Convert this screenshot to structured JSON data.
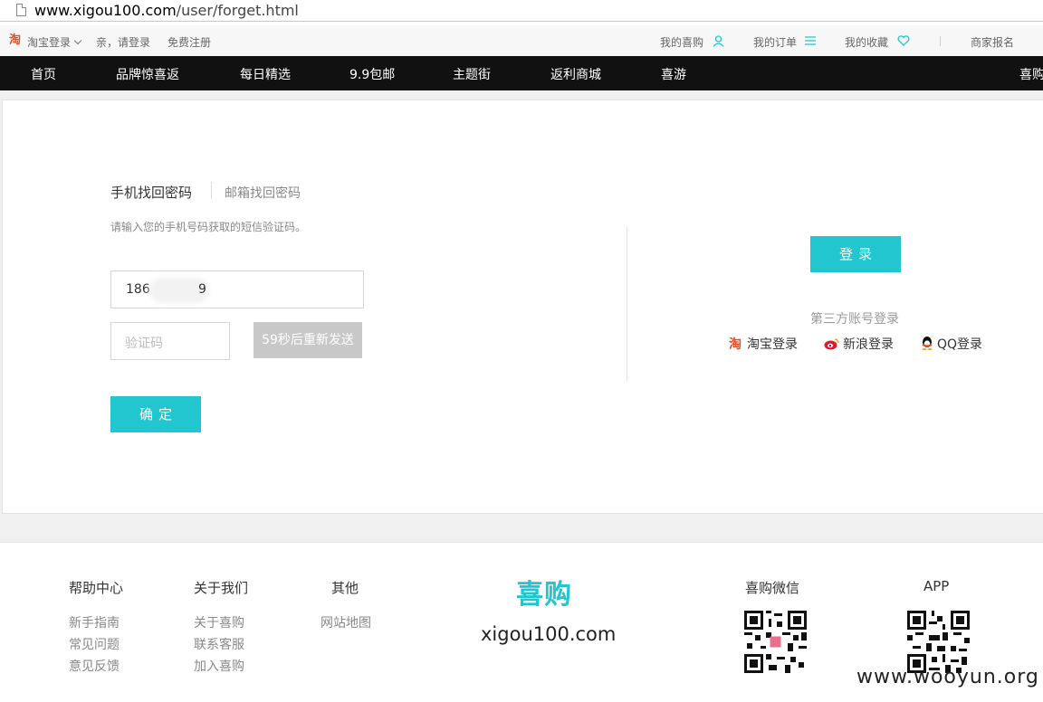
{
  "address_bar": {
    "url_prefix": "www.xigou100.com",
    "url_rest": "/user/forget.html"
  },
  "topbar": {
    "taobao_login": "淘宝登录",
    "greeting": "亲，请登录",
    "register": "免费注册",
    "my_xigou": "我的喜购",
    "my_orders": "我的订单",
    "my_favorites": "我的收藏",
    "merchant_signup": "商家报名",
    "logo_glyph": "淘",
    "accent_color": "#21c6cf"
  },
  "nav": {
    "items": [
      "首页",
      "品牌惊喜返",
      "每日精选",
      "9.9包邮",
      "主题街",
      "返利商城",
      "喜游"
    ],
    "cut_item": "喜购"
  },
  "form": {
    "tab_phone": "手机找回密码",
    "tab_email": "邮箱找回密码",
    "hint": "请输入您的手机号码获取的短信验证码。",
    "phone_value_start": "186",
    "phone_value_end": "9",
    "code_placeholder": "验证码",
    "resend_label": "59秒后重新发送",
    "confirm_label": "确定"
  },
  "side": {
    "login_label": "登录",
    "third_party_title": "第三方账号登录",
    "taobao": "淘宝登录",
    "sina": "新浪登录",
    "qq": "QQ登录"
  },
  "footer": {
    "help_title": "帮助中心",
    "help_links": [
      "新手指南",
      "常见问题",
      "意见反馈"
    ],
    "about_title": "关于我们",
    "about_links": [
      "关于喜购",
      "联系客服",
      "加入喜购"
    ],
    "other_title": "其他",
    "other_links": [
      "网站地图"
    ],
    "brand": "喜购",
    "domain": "xigou100.com",
    "wechat_title": "喜购微信",
    "app_title": "APP"
  },
  "watermark": "www.wooyun.org"
}
